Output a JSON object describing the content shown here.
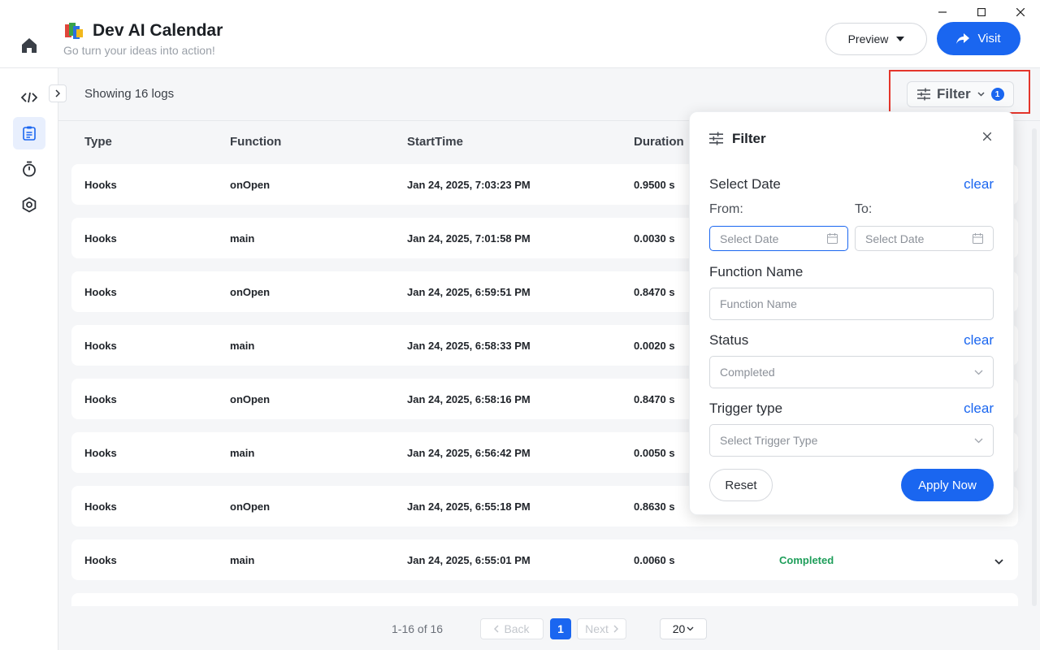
{
  "app": {
    "title": "Dev AI Calendar",
    "subtitle": "Go turn your ideas into action!"
  },
  "header": {
    "preview_label": "Preview",
    "visit_label": "Visit"
  },
  "sidebar": {
    "items": [
      {
        "name": "code-icon",
        "active": false
      },
      {
        "name": "logs-icon",
        "active": true
      },
      {
        "name": "timer-icon",
        "active": false
      },
      {
        "name": "settings-icon",
        "active": false
      }
    ]
  },
  "toolbar": {
    "showing_text": "Showing 16 logs",
    "filter_label": "Filter",
    "filter_count": "1"
  },
  "table": {
    "columns": [
      "Type",
      "Function",
      "StartTime",
      "Duration"
    ],
    "rows": [
      {
        "type": "Hooks",
        "function": "onOpen",
        "start_time": "Jan 24, 2025, 7:03:23 PM",
        "duration": "0.9500 s",
        "status": ""
      },
      {
        "type": "Hooks",
        "function": "main",
        "start_time": "Jan 24, 2025, 7:01:58 PM",
        "duration": "0.0030 s",
        "status": ""
      },
      {
        "type": "Hooks",
        "function": "onOpen",
        "start_time": "Jan 24, 2025, 6:59:51 PM",
        "duration": "0.8470 s",
        "status": ""
      },
      {
        "type": "Hooks",
        "function": "main",
        "start_time": "Jan 24, 2025, 6:58:33 PM",
        "duration": "0.0020 s",
        "status": ""
      },
      {
        "type": "Hooks",
        "function": "onOpen",
        "start_time": "Jan 24, 2025, 6:58:16 PM",
        "duration": "0.8470 s",
        "status": ""
      },
      {
        "type": "Hooks",
        "function": "main",
        "start_time": "Jan 24, 2025, 6:56:42 PM",
        "duration": "0.0050 s",
        "status": ""
      },
      {
        "type": "Hooks",
        "function": "onOpen",
        "start_time": "Jan 24, 2025, 6:55:18 PM",
        "duration": "0.8630 s",
        "status": ""
      },
      {
        "type": "Hooks",
        "function": "main",
        "start_time": "Jan 24, 2025, 6:55:01 PM",
        "duration": "0.0060 s",
        "status": "Completed"
      }
    ]
  },
  "pagination": {
    "range_text": "1-16 of 16",
    "back_label": "Back",
    "next_label": "Next",
    "current_page": "1",
    "page_size": "20"
  },
  "filter_panel": {
    "title": "Filter",
    "select_date_label": "Select Date",
    "clear_label": "clear",
    "from_label": "From:",
    "to_label": "To:",
    "from_placeholder": "Select Date",
    "to_placeholder": "Select Date",
    "function_name_label": "Function Name",
    "function_name_placeholder": "Function Name",
    "status_label": "Status",
    "status_value": "Completed",
    "trigger_type_label": "Trigger type",
    "trigger_type_placeholder": "Select Trigger Type",
    "reset_label": "Reset",
    "apply_label": "Apply Now"
  },
  "colors": {
    "accent": "#1a66f0",
    "status_completed": "#1e9e5a",
    "highlight": "#e4352b"
  }
}
